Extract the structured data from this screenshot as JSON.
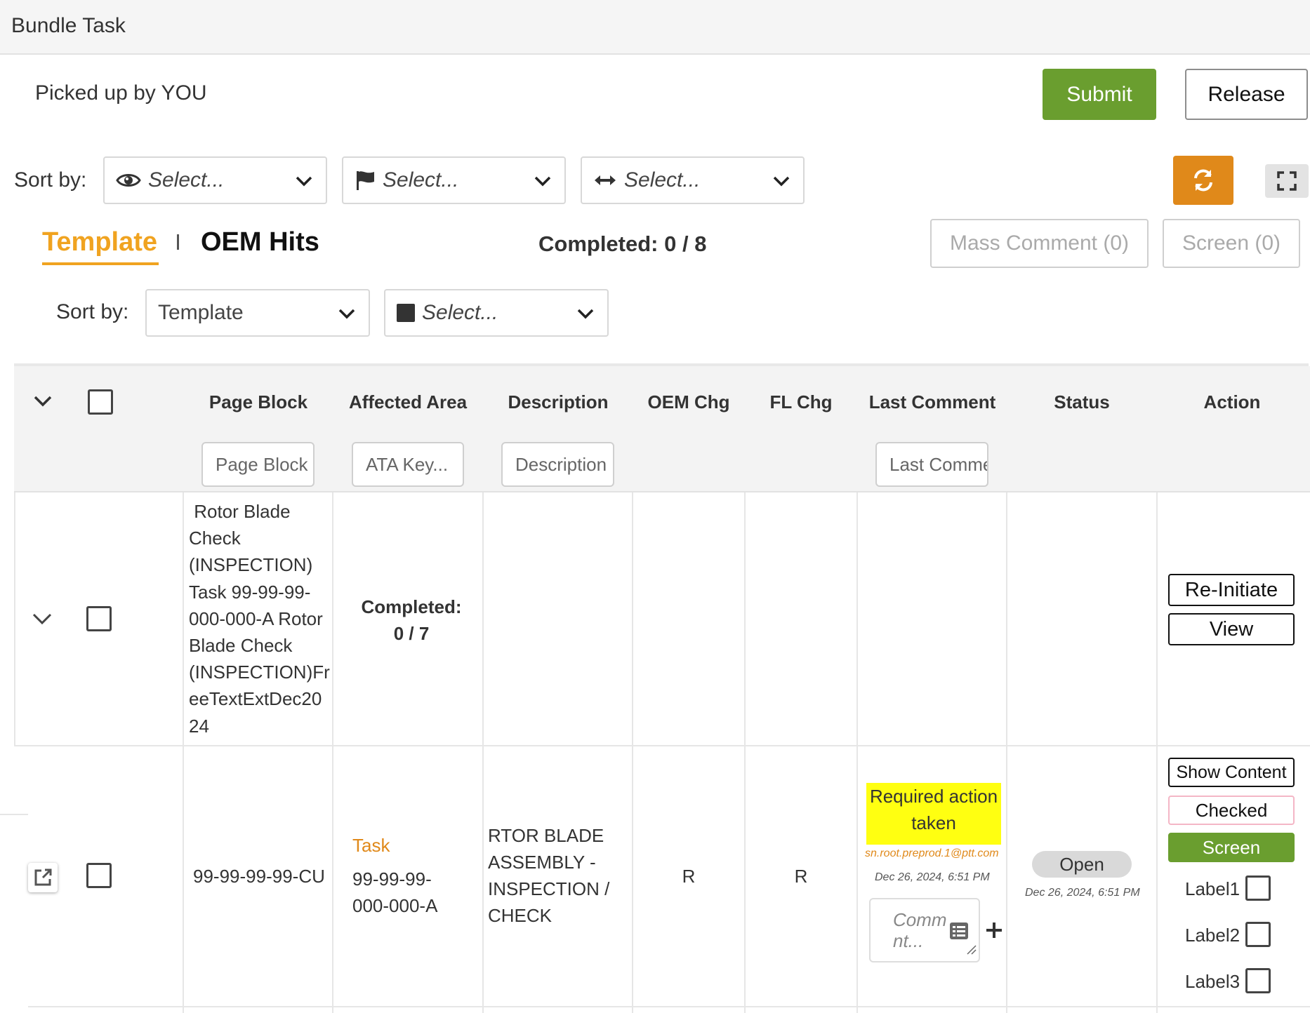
{
  "window": {
    "title": "Bundle Task"
  },
  "header": {
    "picked_up": "Picked up by YOU",
    "submit_label": "Submit",
    "release_label": "Release"
  },
  "sort_bar_1": {
    "label": "Sort by:",
    "selects": [
      {
        "icon": "eye-icon",
        "value": "Select..."
      },
      {
        "icon": "flag-icon",
        "value": "Select..."
      },
      {
        "icon": "arrows-horizontal-icon",
        "value": "Select..."
      }
    ]
  },
  "tabs": [
    {
      "label": "Template",
      "active": true
    },
    {
      "label": "OEM Hits",
      "active": false
    }
  ],
  "completed": "Completed: 0 / 8",
  "mass_comment_label": "Mass Comment (0)",
  "screen_count_label": "Screen (0)",
  "sort_bar_2": {
    "label": "Sort by:",
    "template_select": "Template",
    "color_select": "Select..."
  },
  "table": {
    "columns": [
      "Page Block",
      "Affected Area",
      "Description",
      "OEM Chg",
      "FL Chg",
      "Last Comment",
      "Status",
      "Action"
    ],
    "filters": {
      "page_block": "Page Block",
      "ata_key": "ATA Key...",
      "description": "Description",
      "last_comment": "Last Comment"
    },
    "group_row": {
      "page_block": "Rotor Blade Check (INSPECTION) Task 99-99-99-000-000-A Rotor Blade Check (INSPECTION)FreeTextExtDec2024",
      "page_block_lines": [
        " Rotor Blade",
        "Check",
        "(INSPECTION)",
        "Task 99-99-99-",
        "000-000-A Rotor",
        "Blade Check",
        "(INSPECTION)Fr",
        "eeTextExtDec20",
        "24"
      ],
      "completed_label": "Completed:",
      "completed_value": "0 / 7",
      "actions": {
        "reinitiate": "Re-Initiate",
        "view": "View"
      }
    },
    "task_row": {
      "page_block": "99-99-99-99-CU",
      "area_type": "Task",
      "area_code_1": "99-99-99-",
      "area_code_2": "000-000-A",
      "description_lines": [
        "RTOR BLADE",
        "ASSEMBLY -",
        "INSPECTION /",
        "CHECK"
      ],
      "oem_chg": "R",
      "fl_chg": "R",
      "last_comment": {
        "text_line1": "Required action",
        "text_line2": "taken",
        "author": "sn.root.preprod.1@ptt.com",
        "date": "Dec 26, 2024, 6:51 PM",
        "placeholder_line1": "Comm",
        "placeholder_line2": "nt..."
      },
      "status": {
        "label": "Open",
        "date": "Dec 26, 2024, 6:51 PM"
      },
      "actions": {
        "show_content": "Show Content",
        "checked": "Checked",
        "screen": "Screen",
        "labels": [
          "Label1",
          "Label2",
          "Label3"
        ]
      }
    }
  },
  "colors": {
    "submit": "#6a9e2f",
    "accent": "#f0a320",
    "refresh": "#e0891a",
    "highlight": "#ffff11",
    "screen_button": "#6a9e2f"
  }
}
